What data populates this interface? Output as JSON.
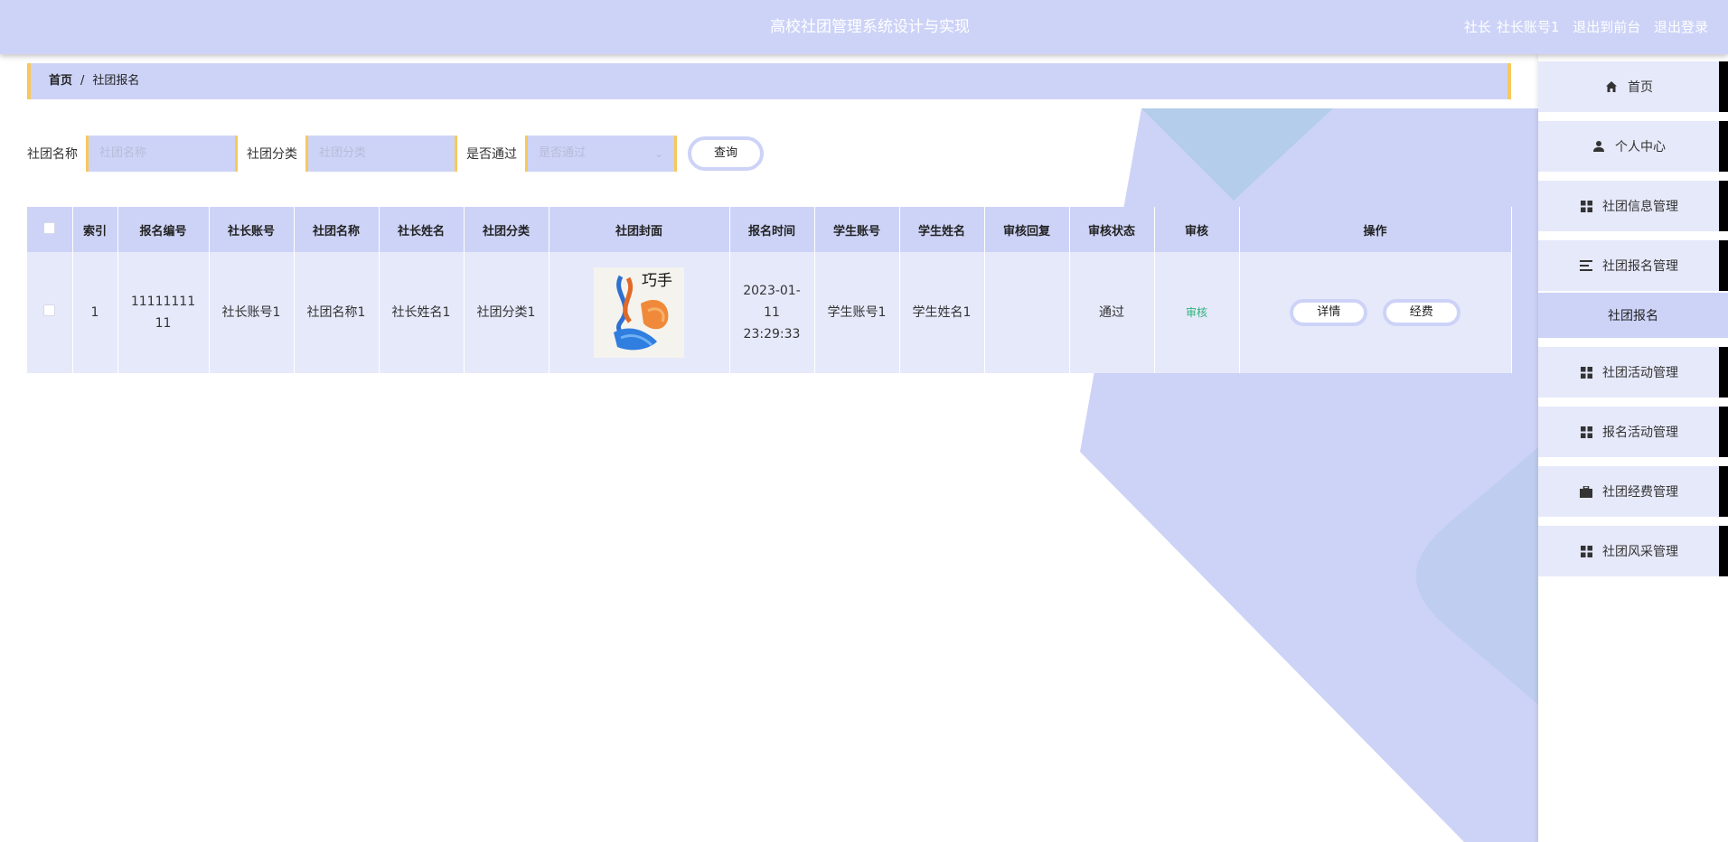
{
  "app": {
    "title": "高校社团管理系统设计与实现"
  },
  "user_area": {
    "role": "社长",
    "account": "社长账号1",
    "back_to_front": "退出到前台",
    "logout": "退出登录"
  },
  "breadcrumb": {
    "home": "首页",
    "separator": "/",
    "current": "社团报名"
  },
  "search": {
    "name_label": "社团名称",
    "name_placeholder": "社团名称",
    "category_label": "社团分类",
    "category_placeholder": "社团分类",
    "passed_label": "是否通过",
    "passed_placeholder": "是否通过",
    "query_button": "查询"
  },
  "table": {
    "headers": [
      "索引",
      "报名编号",
      "社长账号",
      "社团名称",
      "社长姓名",
      "社团分类",
      "社团封面",
      "报名时间",
      "学生账号",
      "学生姓名",
      "审核回复",
      "审核状态",
      "审核",
      "操作"
    ],
    "rows": [
      {
        "index": "1",
        "reg_no": "1111111111",
        "leader_account": "社长账号1",
        "club_name": "社团名称1",
        "leader_name": "社长姓名1",
        "club_category": "社团分类1",
        "cover_text": "巧手",
        "reg_time": "2023-01-11 23:29:33",
        "student_account": "学生账号1",
        "student_name": "学生姓名1",
        "review_reply": "",
        "review_status": "通过",
        "review_link": "审核",
        "detail_button": "详情",
        "fee_button": "经费"
      }
    ]
  },
  "sidebar": {
    "items": [
      {
        "label": "首页",
        "icon": "home-icon"
      },
      {
        "label": "个人中心",
        "icon": "user-icon"
      },
      {
        "label": "社团信息管理",
        "icon": "grid-icon"
      },
      {
        "label": "社团报名管理",
        "icon": "list-icon"
      },
      {
        "label": "社团活动管理",
        "icon": "grid-icon"
      },
      {
        "label": "报名活动管理",
        "icon": "grid-icon"
      },
      {
        "label": "社团经费管理",
        "icon": "briefcase-icon"
      },
      {
        "label": "社团风采管理",
        "icon": "grid-icon"
      }
    ],
    "active_sub": "社团报名"
  },
  "colors": {
    "primary": "#cdd3f7",
    "row": "#e6e9fa",
    "accent": "#f7c85a",
    "status_green": "#2db37d",
    "deco_blue": "#b3cdea"
  }
}
